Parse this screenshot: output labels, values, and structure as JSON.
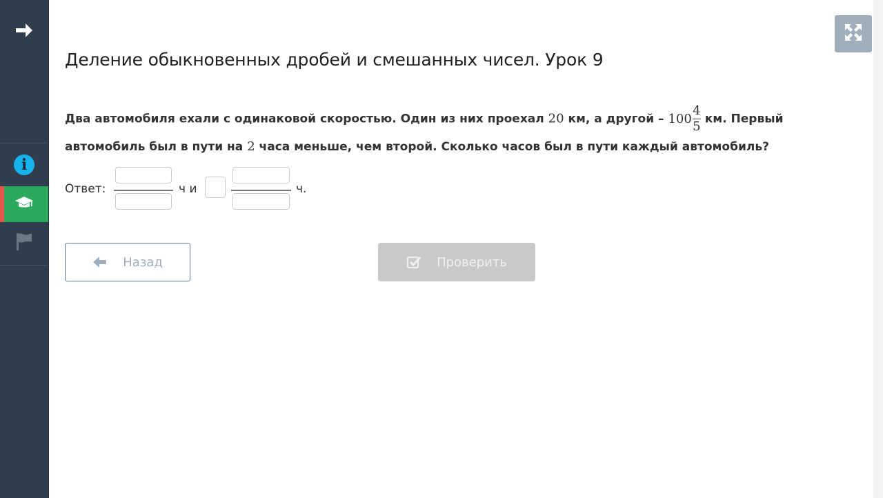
{
  "page": {
    "title": "Деление обыкновенных дробей и смешанных чисел. Урок 9"
  },
  "question": {
    "part1": "Два автомобиля ехали с одинаковой скоростью. Один из них проехал ",
    "num1": "20",
    "part2": " км, а другой – ",
    "mixed_whole": "100",
    "mixed_num": "4",
    "mixed_den": "5",
    "part3": " км. Первый автомобиль был в пути на ",
    "num2": "2",
    "part4": " часа меньше, чем второй. Сколько часов был в пути каждый автомобиль?"
  },
  "answer": {
    "label": "Ответ:",
    "unit_and": "ч и",
    "unit_end": "ч.",
    "fields": {
      "frac1_num": "",
      "frac1_den": "",
      "whole2": "",
      "frac2_num": "",
      "frac2_den": ""
    }
  },
  "buttons": {
    "back_label": "Назад",
    "check_label": "Проверить"
  },
  "sidebar": {
    "icons": [
      "arrow-right-icon",
      "info-icon",
      "graduation-cap-icon",
      "flag-icon"
    ]
  },
  "colors": {
    "sidebar_bg": "#2f3d4c",
    "active_green": "#2aa85c",
    "active_marker": "#e5574d",
    "info_blue": "#17b3ee",
    "check_disabled": "#c9c9c9"
  }
}
